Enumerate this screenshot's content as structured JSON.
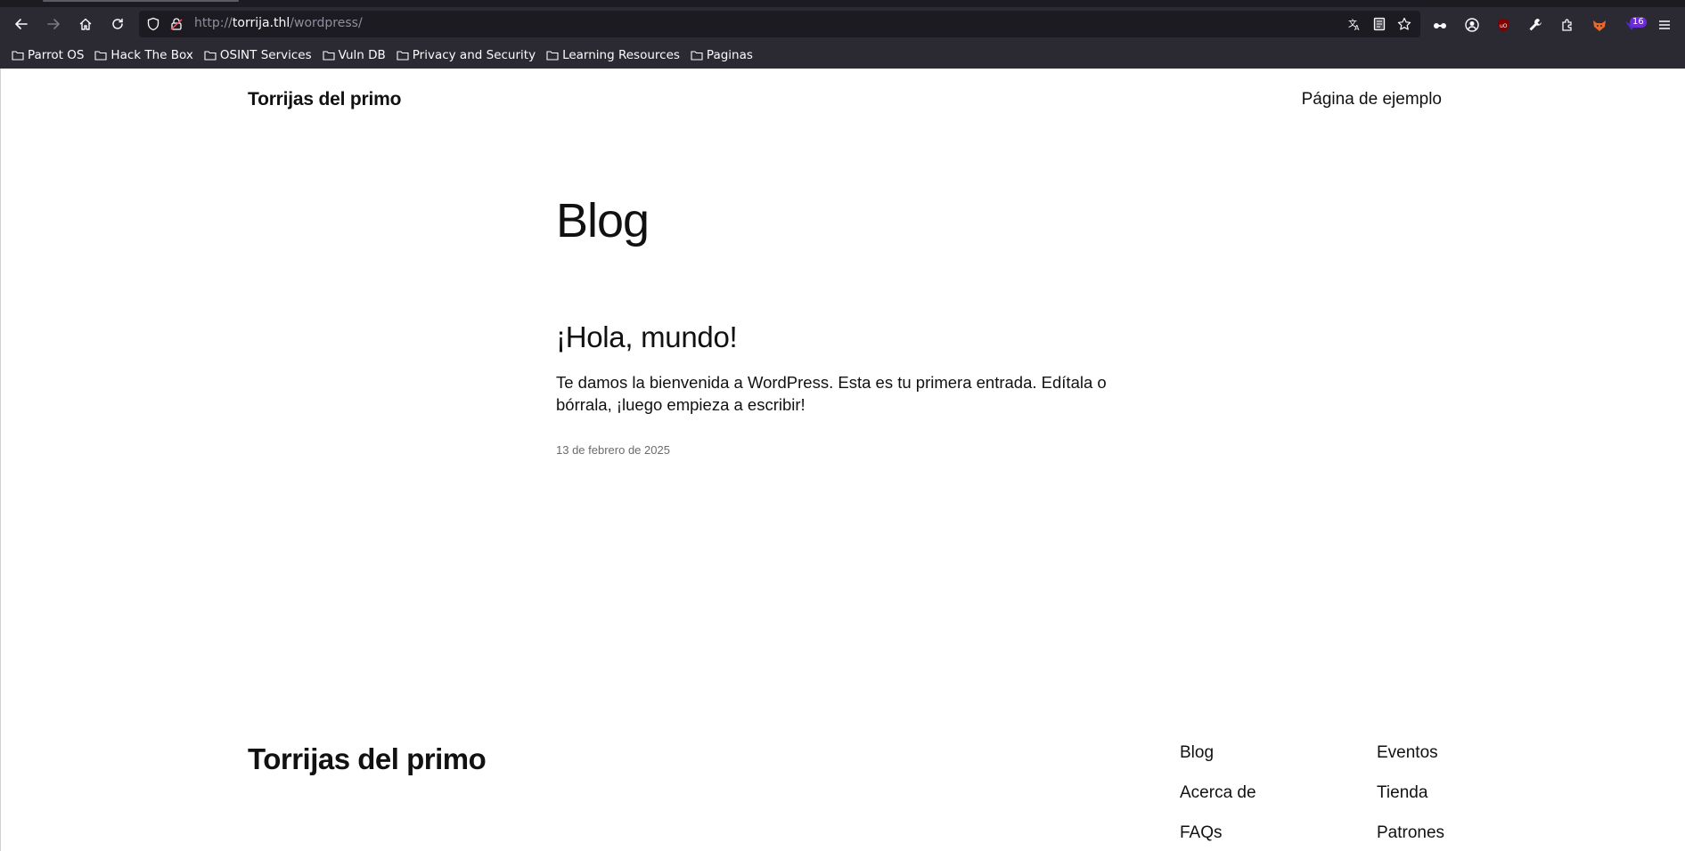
{
  "browser": {
    "url_scheme": "http://",
    "url_host": "torrija.thl",
    "url_path": "/wordpress/",
    "extension_badge": "16",
    "bookmarks": [
      {
        "label": "Parrot OS"
      },
      {
        "label": "Hack The Box"
      },
      {
        "label": "OSINT Services"
      },
      {
        "label": "Vuln DB"
      },
      {
        "label": "Privacy and Security"
      },
      {
        "label": "Learning Resources"
      },
      {
        "label": "Paginas"
      }
    ]
  },
  "site": {
    "title": "Torrijas del primo",
    "header_link": "Página de ejemplo"
  },
  "main": {
    "heading": "Blog",
    "post": {
      "title": "¡Hola, mundo!",
      "excerpt": "Te damos la bienvenida a WordPress. Esta es tu primera entrada. Edítala o bórrala, ¡luego empieza a escribir!",
      "date": "13 de febrero de 2025"
    }
  },
  "footer": {
    "title": "Torrijas del primo",
    "col1": [
      "Blog",
      "Acerca de",
      "FAQs"
    ],
    "col2": [
      "Eventos",
      "Tienda",
      "Patrones"
    ]
  }
}
